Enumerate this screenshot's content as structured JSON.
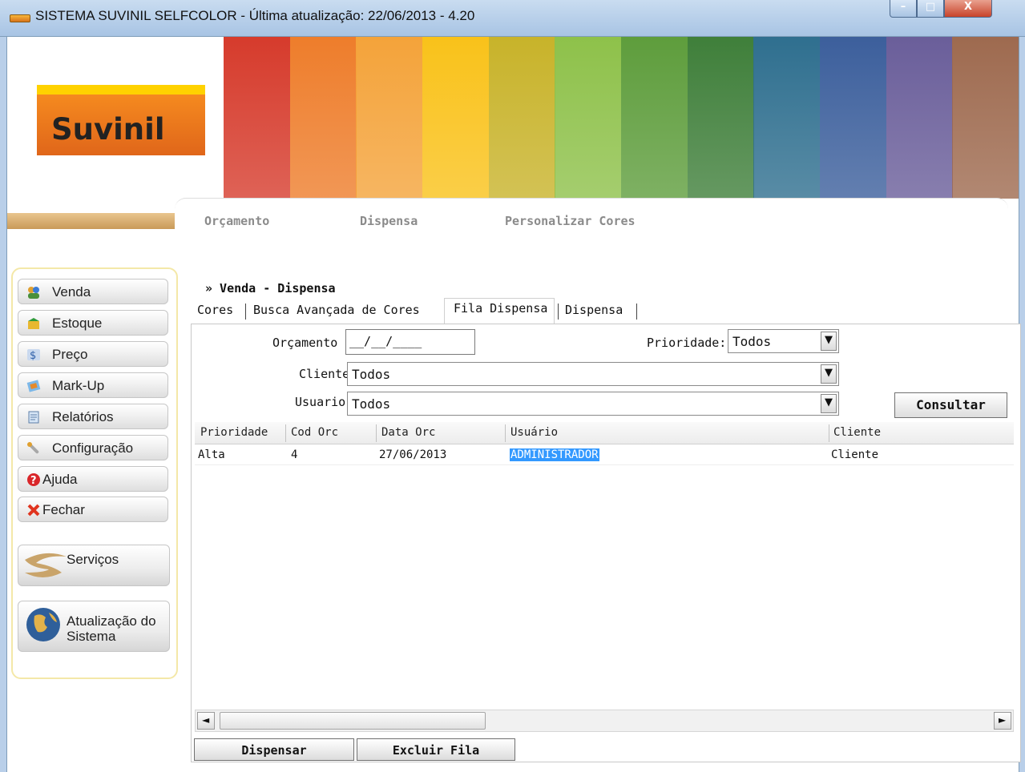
{
  "window": {
    "title": "SISTEMA SUVINIL SELFCOLOR - Última atualização: 22/06/2013 - 4.20",
    "min_symbol": "–",
    "max_symbol": "□",
    "close_symbol": "X"
  },
  "banner": {
    "logo_text": "Suvinil",
    "stripe_colors": [
      "#d63b2c",
      "#ee7d2b",
      "#f4a33a",
      "#f9c21a",
      "#c8b32a",
      "#8ec14a",
      "#5e9d3c",
      "#3f7f3a",
      "#2f6f8f",
      "#3c5f9c",
      "#6a5e9a",
      "#9e6a4f"
    ]
  },
  "menu": {
    "items": [
      "Orçamento",
      "Dispensa",
      "Personalizar Cores"
    ]
  },
  "sidebar": {
    "items": [
      {
        "label": "Venda",
        "icon": "users-icon"
      },
      {
        "label": "Estoque",
        "icon": "box-icon"
      },
      {
        "label": "Preço",
        "icon": "price-tag-icon"
      },
      {
        "label": "Mark-Up",
        "icon": "markup-icon"
      },
      {
        "label": "Relatórios",
        "icon": "report-icon"
      },
      {
        "label": "Configuração",
        "icon": "wrench-icon"
      },
      {
        "label": "Ajuda",
        "icon": "help-icon"
      },
      {
        "label": "Fechar",
        "icon": "close-x-icon"
      }
    ],
    "services_label": "Serviços",
    "update_label_line1": "Atualização do",
    "update_label_line2": "Sistema"
  },
  "breadcrumb": "» Venda - Dispensa",
  "tabs": [
    "Cores",
    "Busca Avançada de Cores",
    "Fila Dispensa",
    "Dispensa"
  ],
  "active_tab": "Fila Dispensa",
  "form": {
    "orcamento_label": "Orçamento",
    "orcamento_value": "__/__/____",
    "prioridade_label": "Prioridade:",
    "prioridade_value": "Todos",
    "cliente_label": "Cliente",
    "cliente_value": "Todos",
    "usuario_label": "Usuario",
    "usuario_value": "Todos",
    "consultar_label": "Consultar"
  },
  "grid": {
    "columns": [
      "Prioridade",
      "Cod Orc",
      "Data Orc",
      "Usuário",
      "Cliente"
    ],
    "rows": [
      [
        "Alta",
        "4",
        "27/06/2013",
        "ADMINISTRADOR",
        "Cliente"
      ]
    ]
  },
  "scrollbar": {
    "left_arrow": "◄",
    "right_arrow": "►"
  },
  "actions": {
    "dispensar_label": "Dispensar",
    "excluir_label": "Excluir Fila"
  },
  "colors": {
    "accent": "#3399ff",
    "logo_orange": "#f58a1f",
    "logo_yellow": "#ffd200"
  }
}
